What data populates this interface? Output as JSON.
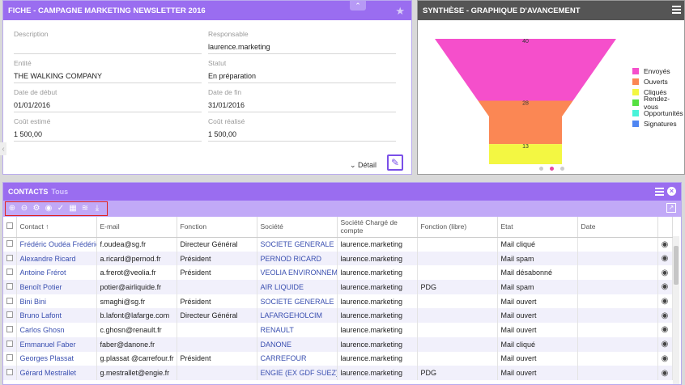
{
  "fiche": {
    "title": "FICHE - CAMPAGNE MARKETING NEWSLETTER 2016",
    "fields": [
      {
        "label": "Description",
        "value": ""
      },
      {
        "label": "Responsable",
        "value": "laurence.marketing"
      },
      {
        "label": "Entité",
        "value": "THE WALKING COMPANY"
      },
      {
        "label": "Statut",
        "value": "En préparation"
      },
      {
        "label": "Date de début",
        "value": "01/01/2016"
      },
      {
        "label": "Date de fin",
        "value": "31/01/2016"
      },
      {
        "label": "Coût estimé",
        "value": "1 500,00"
      },
      {
        "label": "Coût réalisé",
        "value": "1 500,00"
      }
    ],
    "detail_label": "Détail"
  },
  "synthese": {
    "title": "SYNTHÈSE - GRAPHIQUE D'AVANCEMENT",
    "colors": {
      "envoyes": "#f54fcb",
      "ouverts": "#fb8754",
      "cliques": "#f3f742",
      "rendez_vous": "#55e041",
      "opportunites": "#49f3d9",
      "signatures": "#4f86f2"
    }
  },
  "chart_data": {
    "type": "funnel",
    "categories": [
      "Envoyés",
      "Ouverts",
      "Cliqués",
      "Rendez-vous",
      "Opportunités",
      "Signatures"
    ],
    "values": [
      40,
      28,
      13,
      0,
      0,
      0
    ],
    "data_labels": [
      "40",
      "28",
      "13"
    ],
    "legend": "right"
  },
  "contacts": {
    "title": "CONTACTS",
    "subtitle": "Tous",
    "columns": [
      "Contact",
      "E-mail",
      "Fonction",
      "Société",
      "Société Chargé de compte",
      "Fonction (libre)",
      "Etat",
      "Date"
    ],
    "rows": [
      [
        "Frédéric Oudéa Frédéric Oudéa",
        "f.oudea@sg.fr",
        "Directeur Général",
        "SOCIETE GENERALE",
        "laurence.marketing",
        "",
        "Mail cliqué",
        ""
      ],
      [
        "Alexandre Ricard",
        "a.ricard@pernod.fr",
        "Président",
        "PERNOD RICARD",
        "laurence.marketing",
        "",
        "Mail spam",
        ""
      ],
      [
        "Antoine Frérot",
        "a.frerot@veolia.fr",
        "Président",
        "VEOLIA ENVIRONNEMENT",
        "laurence.marketing",
        "",
        "Mail désabonné",
        ""
      ],
      [
        "Benoît Potier",
        "potier@airliquide.fr",
        "",
        "AIR LIQUIDE",
        "laurence.marketing",
        "PDG",
        "Mail spam",
        ""
      ],
      [
        "Bini Bini",
        "smaghi@sg.fr",
        "Président",
        "SOCIETE GENERALE",
        "laurence.marketing",
        "",
        "Mail ouvert",
        ""
      ],
      [
        "Bruno Lafont",
        "b.lafont@lafarge.com",
        "Directeur Général",
        "LAFARGEHOLCIM",
        "laurence.marketing",
        "",
        "Mail ouvert",
        ""
      ],
      [
        "Carlos Ghosn",
        "c.ghosn@renault.fr",
        "",
        "RENAULT",
        "laurence.marketing",
        "",
        "Mail ouvert",
        ""
      ],
      [
        "Emmanuel Faber",
        "faber@danone.fr",
        "",
        "DANONE",
        "laurence.marketing",
        "",
        "Mail cliqué",
        ""
      ],
      [
        "Georges Plassat",
        "g.plassat @carrefour.fr",
        "Président",
        "CARREFOUR",
        "laurence.marketing",
        "",
        "Mail ouvert",
        ""
      ],
      [
        "Gérard Mestrallet",
        "g.mestrallet@engie.fr",
        "",
        "ENGIE (EX GDF SUEZ)",
        "laurence.marketing",
        "PDG",
        "Mail ouvert",
        ""
      ]
    ]
  }
}
